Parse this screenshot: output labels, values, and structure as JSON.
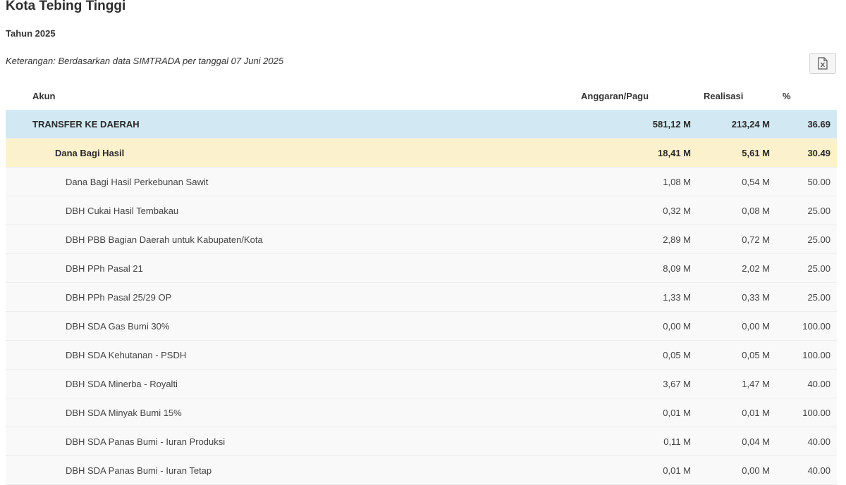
{
  "page": {
    "title": "Kota Tebing Tinggi",
    "year": "Tahun 2025",
    "note": "Keterangan: Berdasarkan data SIMTRADA per tanggal 07 Juni 2025",
    "export_icon": "excel-export-icon"
  },
  "table": {
    "headers": {
      "akun": "Akun",
      "pagu": "Anggaran/Pagu",
      "realisasi": "Realisasi",
      "pct": "%"
    },
    "rows": [
      {
        "level": 0,
        "akun": "TRANSFER KE DAERAH",
        "pagu": "581,12 M",
        "realisasi": "213,24 M",
        "pct": "36.69"
      },
      {
        "level": 1,
        "akun": "Dana Bagi Hasil",
        "pagu": "18,41 M",
        "realisasi": "5,61 M",
        "pct": "30.49"
      },
      {
        "level": 2,
        "akun": "Dana Bagi Hasil Perkebunan Sawit",
        "pagu": "1,08 M",
        "realisasi": "0,54 M",
        "pct": "50.00"
      },
      {
        "level": 2,
        "akun": "DBH Cukai Hasil Tembakau",
        "pagu": "0,32 M",
        "realisasi": "0,08 M",
        "pct": "25.00"
      },
      {
        "level": 2,
        "akun": "DBH PBB Bagian Daerah untuk Kabupaten/Kota",
        "pagu": "2,89 M",
        "realisasi": "0,72 M",
        "pct": "25.00"
      },
      {
        "level": 2,
        "akun": "DBH PPh Pasal 21",
        "pagu": "8,09 M",
        "realisasi": "2,02 M",
        "pct": "25.00"
      },
      {
        "level": 2,
        "akun": "DBH PPh Pasal 25/29 OP",
        "pagu": "1,33 M",
        "realisasi": "0,33 M",
        "pct": "25.00"
      },
      {
        "level": 2,
        "akun": "DBH SDA Gas Bumi 30%",
        "pagu": "0,00 M",
        "realisasi": "0,00 M",
        "pct": "100.00"
      },
      {
        "level": 2,
        "akun": "DBH SDA Kehutanan - PSDH",
        "pagu": "0,05 M",
        "realisasi": "0,05 M",
        "pct": "100.00"
      },
      {
        "level": 2,
        "akun": "DBH SDA Minerba - Royalti",
        "pagu": "3,67 M",
        "realisasi": "1,47 M",
        "pct": "40.00"
      },
      {
        "level": 2,
        "akun": "DBH SDA Minyak Bumi 15%",
        "pagu": "0,01 M",
        "realisasi": "0,01 M",
        "pct": "100.00"
      },
      {
        "level": 2,
        "akun": "DBH SDA Panas Bumi - Iuran Produksi",
        "pagu": "0,11 M",
        "realisasi": "0,04 M",
        "pct": "40.00"
      },
      {
        "level": 2,
        "akun": "DBH SDA Panas Bumi - Iuran Tetap",
        "pagu": "0,01 M",
        "realisasi": "0,00 M",
        "pct": "40.00"
      }
    ]
  }
}
